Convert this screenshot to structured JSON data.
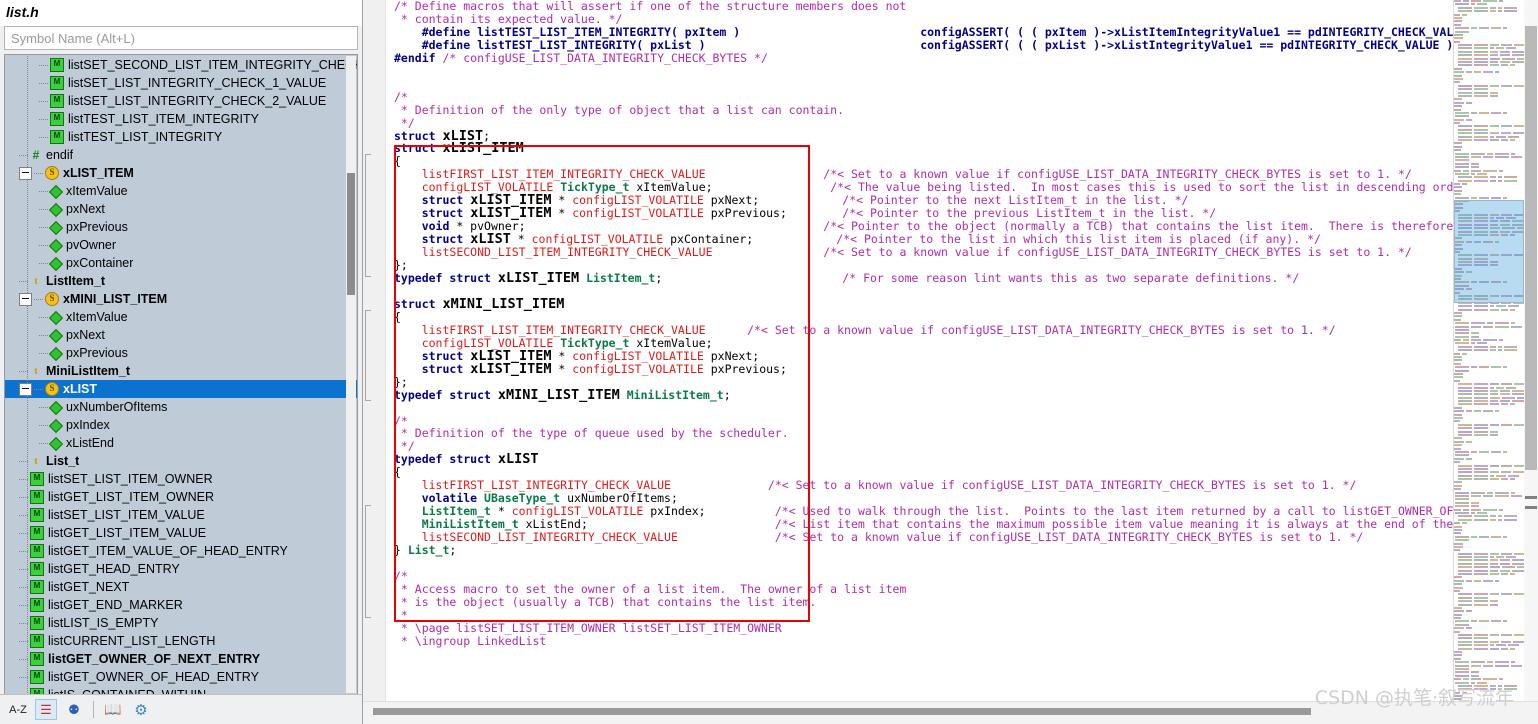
{
  "sidebar": {
    "title": "list.h",
    "search_placeholder": "Symbol Name (Alt+L)",
    "search_value": "",
    "tree": [
      {
        "label": "listSET_SECOND_LIST_ITEM_INTEGRITY_CHECK_V",
        "kind": "macro",
        "depth": 2,
        "bold": false,
        "selected": false,
        "expander": false
      },
      {
        "label": "listSET_LIST_INTEGRITY_CHECK_1_VALUE",
        "kind": "macro",
        "depth": 2,
        "bold": false,
        "selected": false,
        "expander": false
      },
      {
        "label": "listSET_LIST_INTEGRITY_CHECK_2_VALUE",
        "kind": "macro",
        "depth": 2,
        "bold": false,
        "selected": false,
        "expander": false
      },
      {
        "label": "listTEST_LIST_ITEM_INTEGRITY",
        "kind": "macro",
        "depth": 2,
        "bold": false,
        "selected": false,
        "expander": false
      },
      {
        "label": "listTEST_LIST_INTEGRITY",
        "kind": "macro",
        "depth": 2,
        "bold": false,
        "selected": false,
        "expander": false
      },
      {
        "label": "endif",
        "kind": "hash",
        "depth": 1,
        "bold": false,
        "selected": false,
        "expander": false
      },
      {
        "label": "xLIST_ITEM",
        "kind": "struct",
        "depth": 1,
        "bold": true,
        "selected": false,
        "expander": true
      },
      {
        "label": "xItemValue",
        "kind": "field",
        "depth": 2,
        "bold": false,
        "selected": false,
        "expander": false
      },
      {
        "label": "pxNext",
        "kind": "field",
        "depth": 2,
        "bold": false,
        "selected": false,
        "expander": false
      },
      {
        "label": "pxPrevious",
        "kind": "field",
        "depth": 2,
        "bold": false,
        "selected": false,
        "expander": false
      },
      {
        "label": "pvOwner",
        "kind": "field",
        "depth": 2,
        "bold": false,
        "selected": false,
        "expander": false
      },
      {
        "label": "pxContainer",
        "kind": "field",
        "depth": 2,
        "bold": false,
        "selected": false,
        "expander": false
      },
      {
        "label": "ListItem_t",
        "kind": "typedef",
        "depth": 1,
        "bold": true,
        "selected": false,
        "expander": false
      },
      {
        "label": "xMINI_LIST_ITEM",
        "kind": "struct",
        "depth": 1,
        "bold": true,
        "selected": false,
        "expander": true
      },
      {
        "label": "xItemValue",
        "kind": "field",
        "depth": 2,
        "bold": false,
        "selected": false,
        "expander": false
      },
      {
        "label": "pxNext",
        "kind": "field",
        "depth": 2,
        "bold": false,
        "selected": false,
        "expander": false
      },
      {
        "label": "pxPrevious",
        "kind": "field",
        "depth": 2,
        "bold": false,
        "selected": false,
        "expander": false
      },
      {
        "label": "MiniListItem_t",
        "kind": "typedef",
        "depth": 1,
        "bold": true,
        "selected": false,
        "expander": false
      },
      {
        "label": "xLIST",
        "kind": "struct",
        "depth": 1,
        "bold": true,
        "selected": true,
        "expander": true
      },
      {
        "label": "uxNumberOfItems",
        "kind": "field",
        "depth": 2,
        "bold": false,
        "selected": false,
        "expander": false
      },
      {
        "label": "pxIndex",
        "kind": "field",
        "depth": 2,
        "bold": false,
        "selected": false,
        "expander": false
      },
      {
        "label": "xListEnd",
        "kind": "field",
        "depth": 2,
        "bold": false,
        "selected": false,
        "expander": false
      },
      {
        "label": "List_t",
        "kind": "typedef",
        "depth": 1,
        "bold": true,
        "selected": false,
        "expander": false
      },
      {
        "label": "listSET_LIST_ITEM_OWNER",
        "kind": "macro",
        "depth": 1,
        "bold": false,
        "selected": false,
        "expander": false
      },
      {
        "label": "listGET_LIST_ITEM_OWNER",
        "kind": "macro",
        "depth": 1,
        "bold": false,
        "selected": false,
        "expander": false
      },
      {
        "label": "listSET_LIST_ITEM_VALUE",
        "kind": "macro",
        "depth": 1,
        "bold": false,
        "selected": false,
        "expander": false
      },
      {
        "label": "listGET_LIST_ITEM_VALUE",
        "kind": "macro",
        "depth": 1,
        "bold": false,
        "selected": false,
        "expander": false
      },
      {
        "label": "listGET_ITEM_VALUE_OF_HEAD_ENTRY",
        "kind": "macro",
        "depth": 1,
        "bold": false,
        "selected": false,
        "expander": false
      },
      {
        "label": "listGET_HEAD_ENTRY",
        "kind": "macro",
        "depth": 1,
        "bold": false,
        "selected": false,
        "expander": false
      },
      {
        "label": "listGET_NEXT",
        "kind": "macro",
        "depth": 1,
        "bold": false,
        "selected": false,
        "expander": false
      },
      {
        "label": "listGET_END_MARKER",
        "kind": "macro",
        "depth": 1,
        "bold": false,
        "selected": false,
        "expander": false
      },
      {
        "label": "listLIST_IS_EMPTY",
        "kind": "macro",
        "depth": 1,
        "bold": false,
        "selected": false,
        "expander": false
      },
      {
        "label": "listCURRENT_LIST_LENGTH",
        "kind": "macro",
        "depth": 1,
        "bold": false,
        "selected": false,
        "expander": false
      },
      {
        "label": "listGET_OWNER_OF_NEXT_ENTRY",
        "kind": "macro",
        "depth": 1,
        "bold": true,
        "selected": false,
        "expander": false
      },
      {
        "label": "listGET_OWNER_OF_HEAD_ENTRY",
        "kind": "macro",
        "depth": 1,
        "bold": false,
        "selected": false,
        "expander": false
      },
      {
        "label": "listIS_CONTAINED_WITHIN",
        "kind": "macro",
        "depth": 1,
        "bold": false,
        "selected": false,
        "expander": false
      }
    ],
    "toolbar": [
      {
        "name": "sort-alphabetically-button",
        "glyph": "A-Z",
        "active": false
      },
      {
        "name": "group-by-category-button",
        "glyph": "☰",
        "active": true
      },
      {
        "name": "filter-members-button",
        "glyph": "⚉",
        "active": false
      },
      {
        "name": "documentation-button",
        "glyph": "📖",
        "active": false
      },
      {
        "name": "settings-button",
        "glyph": "⚙",
        "active": false
      }
    ]
  },
  "editor": {
    "code_lines": [
      "/* Define macros that will assert if one of the structure members does not",
      " * contain its expected value. */",
      "    #define listTEST_LIST_ITEM_INTEGRITY( pxItem )                          configASSERT( ( ( pxItem )->xListItemIntegrityValue1 == pdINTEGRITY_CHECK_VALUE",
      "    #define listTEST_LIST_INTEGRITY( pxList )                               configASSERT( ( ( pxList )->xListIntegrityValue1 == pdINTEGRITY_CHECK_VALUE ) &&",
      "#endif /* configUSE_LIST_DATA_INTEGRITY_CHECK_BYTES */",
      "",
      "",
      "/*",
      " * Definition of the only type of object that a list can contain.",
      " */",
      "struct xLIST;",
      "struct xLIST_ITEM",
      "{",
      "    listFIRST_LIST_ITEM_INTEGRITY_CHECK_VALUE                 /*< Set to a known value if configUSE_LIST_DATA_INTEGRITY_CHECK_BYTES is set to 1. */",
      "    configLIST_VOLATILE TickType_t xItemValue;                 /*< The value being listed.  In most cases this is used to sort the list in descending order",
      "    struct xLIST_ITEM * configLIST_VOLATILE pxNext;            /*< Pointer to the next ListItem_t in the list. */",
      "    struct xLIST_ITEM * configLIST_VOLATILE pxPrevious;        /*< Pointer to the previous ListItem_t in the list. */",
      "    void * pvOwner;                                           /*< Pointer to the object (normally a TCB) that contains the list item.  There is therefore",
      "    struct xLIST * configLIST_VOLATILE pxContainer;            /*< Pointer to the list in which this list item is placed (if any). */",
      "    listSECOND_LIST_ITEM_INTEGRITY_CHECK_VALUE                /*< Set to a known value if configUSE_LIST_DATA_INTEGRITY_CHECK_BYTES is set to 1. */",
      "};",
      "typedef struct xLIST_ITEM ListItem_t;                          /* For some reason lint wants this as two separate definitions. */",
      "",
      "struct xMINI_LIST_ITEM",
      "{",
      "    listFIRST_LIST_ITEM_INTEGRITY_CHECK_VALUE      /*< Set to a known value if configUSE_LIST_DATA_INTEGRITY_CHECK_BYTES is set to 1. */",
      "    configLIST_VOLATILE TickType_t xItemValue;",
      "    struct xLIST_ITEM * configLIST_VOLATILE pxNext;",
      "    struct xLIST_ITEM * configLIST_VOLATILE pxPrevious;",
      "};",
      "typedef struct xMINI_LIST_ITEM MiniListItem_t;",
      "",
      "/*",
      " * Definition of the type of queue used by the scheduler.",
      " */",
      "typedef struct xLIST",
      "{",
      "    listFIRST_LIST_INTEGRITY_CHECK_VALUE              /*< Set to a known value if configUSE_LIST_DATA_INTEGRITY_CHECK_BYTES is set to 1. */",
      "    volatile UBaseType_t uxNumberOfItems;",
      "    ListItem_t * configLIST_VOLATILE pxIndex;          /*< Used to walk through the list.  Points to the last item returned by a call to listGET_OWNER_OF_NEX",
      "    MiniListItem_t xListEnd;                           /*< List item that contains the maximum possible item value meaning it is always at the end of the lis",
      "    listSECOND_LIST_INTEGRITY_CHECK_VALUE              /*< Set to a known value if configUSE_LIST_DATA_INTEGRITY_CHECK_BYTES is set to 1. */",
      "} List_t;",
      "",
      "/*",
      " * Access macro to set the owner of a list item.  The owner of a list item",
      " * is the object (usually a TCB) that contains the list item.",
      " *",
      " * \\page listSET_LIST_ITEM_OWNER listSET_LIST_ITEM_OWNER",
      " * \\ingroup LinkedList"
    ],
    "highlight_box_color": "#ee0000"
  },
  "watermark": "CSDN @执笔·叙写流年"
}
